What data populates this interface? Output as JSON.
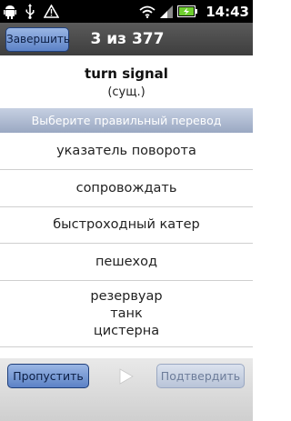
{
  "status_bar": {
    "time": "14:43",
    "icons": [
      "android-icon",
      "usb-icon",
      "warning-icon",
      "wifi-icon",
      "signal-icon",
      "battery-charging-icon"
    ]
  },
  "header": {
    "finish_label": "Завершить",
    "counter": "3 из 377"
  },
  "card": {
    "word": "turn signal",
    "part_of_speech": "(сущ.)"
  },
  "instruction": "Выберите правильный перевод",
  "options": [
    {
      "lines": [
        "указатель поворота"
      ]
    },
    {
      "lines": [
        "сопровождать"
      ]
    },
    {
      "lines": [
        "быстроходный катер"
      ]
    },
    {
      "lines": [
        "пешеход"
      ]
    },
    {
      "lines": [
        "резервуар",
        "танк",
        "цистерна"
      ]
    }
  ],
  "toolbar": {
    "skip_label": "Пропустить",
    "play_icon": "play-icon",
    "confirm_label": "Подтвердить"
  },
  "colors": {
    "header_bg": "#4a4a4a",
    "button_blue": "#7ea0d8",
    "instruction_bg": "#aeb9cf",
    "disabled_text": "#6d7d9a"
  }
}
